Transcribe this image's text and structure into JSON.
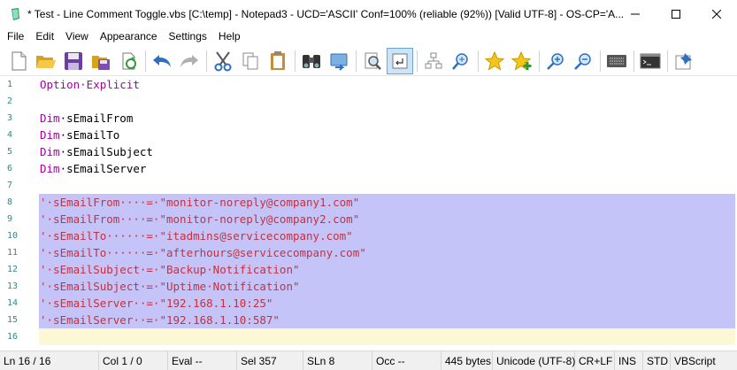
{
  "window": {
    "title": "* Test - Line Comment Toggle.vbs [C:\\temp] - Notepad3 - UCD='ASCII' Conf=100% (reliable (92%)) [Valid UTF-8] - OS-CP='A..."
  },
  "menu": [
    "File",
    "Edit",
    "View",
    "Appearance",
    "Settings",
    "Help"
  ],
  "toolbar": {
    "buttons": [
      "new-file",
      "open-folder",
      "save",
      "save-as",
      "reload",
      "undo",
      "redo",
      "cut",
      "copy",
      "paste",
      "find",
      "replace",
      "find-in-files",
      "word-wrap",
      "tree",
      "go-to",
      "bookmark",
      "bookmark-add",
      "zoom-in",
      "zoom-out",
      "encoding",
      "console",
      "pin"
    ]
  },
  "editor": {
    "lines": [
      {
        "num": "1",
        "tokens": [
          {
            "t": "Option·Explicit",
            "c": "kw"
          }
        ]
      },
      {
        "num": "2",
        "tokens": []
      },
      {
        "num": "3",
        "tokens": [
          {
            "t": "Dim",
            "c": "kw"
          },
          {
            "t": "·sEmailFrom",
            "c": "plain"
          }
        ]
      },
      {
        "num": "4",
        "tokens": [
          {
            "t": "Dim",
            "c": "kw"
          },
          {
            "t": "·sEmailTo",
            "c": "plain"
          }
        ]
      },
      {
        "num": "5",
        "tokens": [
          {
            "t": "Dim",
            "c": "kw"
          },
          {
            "t": "·sEmailSubject",
            "c": "plain"
          }
        ]
      },
      {
        "num": "6",
        "tokens": [
          {
            "t": "Dim",
            "c": "kw"
          },
          {
            "t": "·sEmailServer",
            "c": "plain"
          }
        ]
      },
      {
        "num": "7",
        "tokens": []
      },
      {
        "num": "8",
        "sel": true,
        "tokens": [
          {
            "t": "'·sEmailFrom····=·\"monitor-noreply@company1.com\"",
            "c": "cmt"
          }
        ]
      },
      {
        "num": "9",
        "sel": true,
        "tokens": [
          {
            "t": "'·sEmailFrom····=·\"monitor-noreply@company2.com\"",
            "c": "cmt"
          }
        ]
      },
      {
        "num": "10",
        "sel": true,
        "tokens": [
          {
            "t": "'·sEmailTo······=·\"itadmins@servicecompany.com\"",
            "c": "cmt"
          }
        ]
      },
      {
        "num": "11",
        "sel": true,
        "tokens": [
          {
            "t": "'·sEmailTo······=·\"afterhours@servicecompany.com\"",
            "c": "cmt"
          }
        ]
      },
      {
        "num": "12",
        "sel": true,
        "tokens": [
          {
            "t": "'·sEmailSubject·=·\"Backup·Notification\"",
            "c": "cmt"
          }
        ]
      },
      {
        "num": "13",
        "sel": true,
        "tokens": [
          {
            "t": "'·sEmailSubject·=·\"Uptime·Notification\"",
            "c": "cmt"
          }
        ]
      },
      {
        "num": "14",
        "sel": true,
        "tokens": [
          {
            "t": "'·sEmailServer··=·\"192.168.1.10:25\"",
            "c": "cmt"
          }
        ]
      },
      {
        "num": "15",
        "sel": true,
        "tokens": [
          {
            "t": "'·sEmailServer··=·\"192.168.1.10:587\"",
            "c": "cmt"
          }
        ]
      },
      {
        "num": "16",
        "cur": true,
        "tokens": []
      }
    ]
  },
  "status": {
    "ln": "Ln  16 / 16",
    "col": "Col  1 / 0",
    "eval": "Eval  --",
    "sel": "Sel  357",
    "sln": "SLn  8",
    "occ": "Occ  --",
    "size": "445 bytes",
    "encoding": "Unicode (UTF-8)",
    "eol": "CR+LF",
    "ins": "INS",
    "std": "STD",
    "lexer": "VBScript"
  },
  "colors": {
    "keyword": "#a300a3",
    "comment": "#c5313f",
    "selection": "#c4c4f8",
    "current_line": "#fcf7d4",
    "line_number": "#2e8b8b"
  }
}
